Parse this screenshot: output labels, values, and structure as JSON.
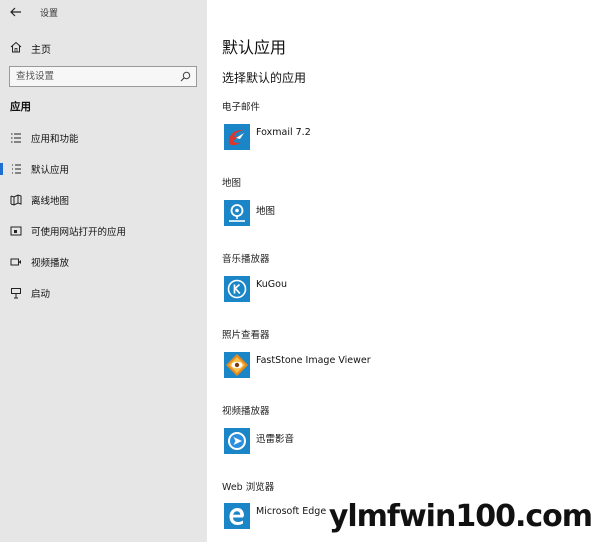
{
  "window": {
    "title": "设置"
  },
  "sidebar": {
    "home_label": "主页",
    "search_placeholder": "查找设置",
    "section_title": "应用",
    "items": [
      {
        "label": "应用和功能",
        "icon": "list-icon"
      },
      {
        "label": "默认应用",
        "icon": "default-apps-icon",
        "active": true
      },
      {
        "label": "离线地图",
        "icon": "map-icon"
      },
      {
        "label": "可使用网站打开的应用",
        "icon": "website-icon"
      },
      {
        "label": "视频播放",
        "icon": "video-icon"
      },
      {
        "label": "启动",
        "icon": "startup-icon"
      }
    ]
  },
  "main": {
    "title": "默认应用",
    "subtitle": "选择默认的应用",
    "categories": [
      {
        "label": "电子邮件",
        "app": "Foxmail 7.2",
        "icon": "foxmail-icon"
      },
      {
        "label": "地图",
        "app": "地图",
        "icon": "maps-app-icon"
      },
      {
        "label": "音乐播放器",
        "app": "KuGou",
        "icon": "kugou-icon"
      },
      {
        "label": "照片查看器",
        "app": "FastStone Image Viewer",
        "icon": "faststone-icon"
      },
      {
        "label": "视频播放器",
        "app": "迅雷影音",
        "icon": "xunlei-icon"
      },
      {
        "label": "Web 浏览器",
        "app": "Microsoft Edge",
        "icon": "edge-icon"
      }
    ]
  },
  "watermark": "ylmfwin100.com",
  "colors": {
    "sidebar_bg": "#e6e6e6",
    "accent": "#1f6fd1",
    "icon_tile": "#1a86c7"
  }
}
